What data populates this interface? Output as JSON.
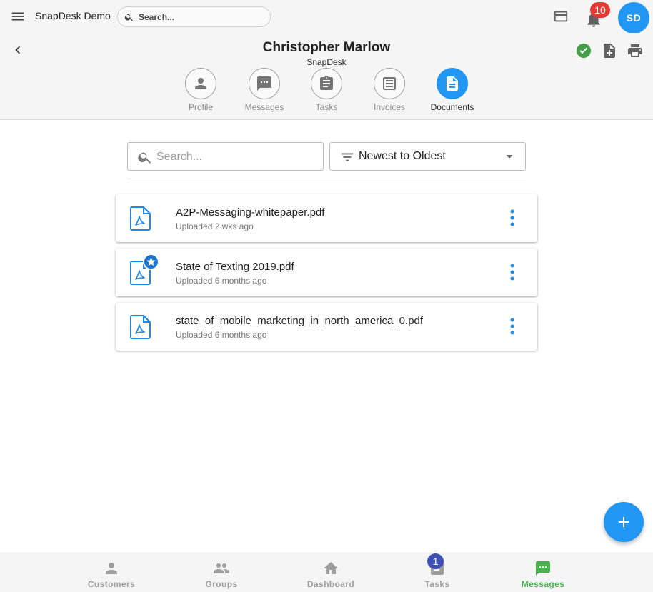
{
  "appbar": {
    "title": "SnapDesk Demo",
    "search_placeholder": "Search...",
    "notification_count": "10",
    "avatar_initials": "SD",
    "icons": [
      "menu-icon",
      "search-icon",
      "credit-card-icon",
      "bell-icon"
    ]
  },
  "profile": {
    "name": "Christopher Marlow",
    "company": "SnapDesk",
    "header_icons": [
      "back-icon",
      "check-circle-icon",
      "add-document-icon",
      "print-icon"
    ],
    "status_color": "#43a047",
    "tabs": [
      {
        "label": "Profile",
        "icon": "person-icon",
        "active": false
      },
      {
        "label": "Messages",
        "icon": "chat-icon",
        "active": false
      },
      {
        "label": "Tasks",
        "icon": "clipboard-icon",
        "active": false
      },
      {
        "label": "Invoices",
        "icon": "receipt-icon",
        "active": false
      },
      {
        "label": "Documents",
        "icon": "document-icon",
        "active": true
      }
    ]
  },
  "filters": {
    "search_placeholder": "Search...",
    "sort_value": "Newest to Oldest"
  },
  "documents": [
    {
      "name": "A2P-Messaging-whitepaper.pdf",
      "meta": "Uploaded 2 wks ago",
      "starred": false
    },
    {
      "name": "State of Texting 2019.pdf",
      "meta": "Uploaded 6 months ago",
      "starred": true
    },
    {
      "name": "state_of_mobile_marketing_in_north_america_0.pdf",
      "meta": "Uploaded 6 months ago",
      "starred": false
    }
  ],
  "fab": {
    "icon": "plus-icon"
  },
  "bottom_nav": {
    "items": [
      {
        "label": "Customers",
        "icon": "person-icon",
        "active": false
      },
      {
        "label": "Groups",
        "icon": "people-icon",
        "active": false
      },
      {
        "label": "Dashboard",
        "icon": "home-icon",
        "active": false
      },
      {
        "label": "Tasks",
        "icon": "task-icon",
        "active": false
      },
      {
        "label": "Messages",
        "icon": "chat-icon",
        "active": true
      }
    ],
    "tasks_badge": "1"
  },
  "colors": {
    "accent": "#2196f3",
    "notification_badge": "#e53935",
    "active_nav": "#4caf50",
    "tasks_badge": "#3f51b5"
  }
}
